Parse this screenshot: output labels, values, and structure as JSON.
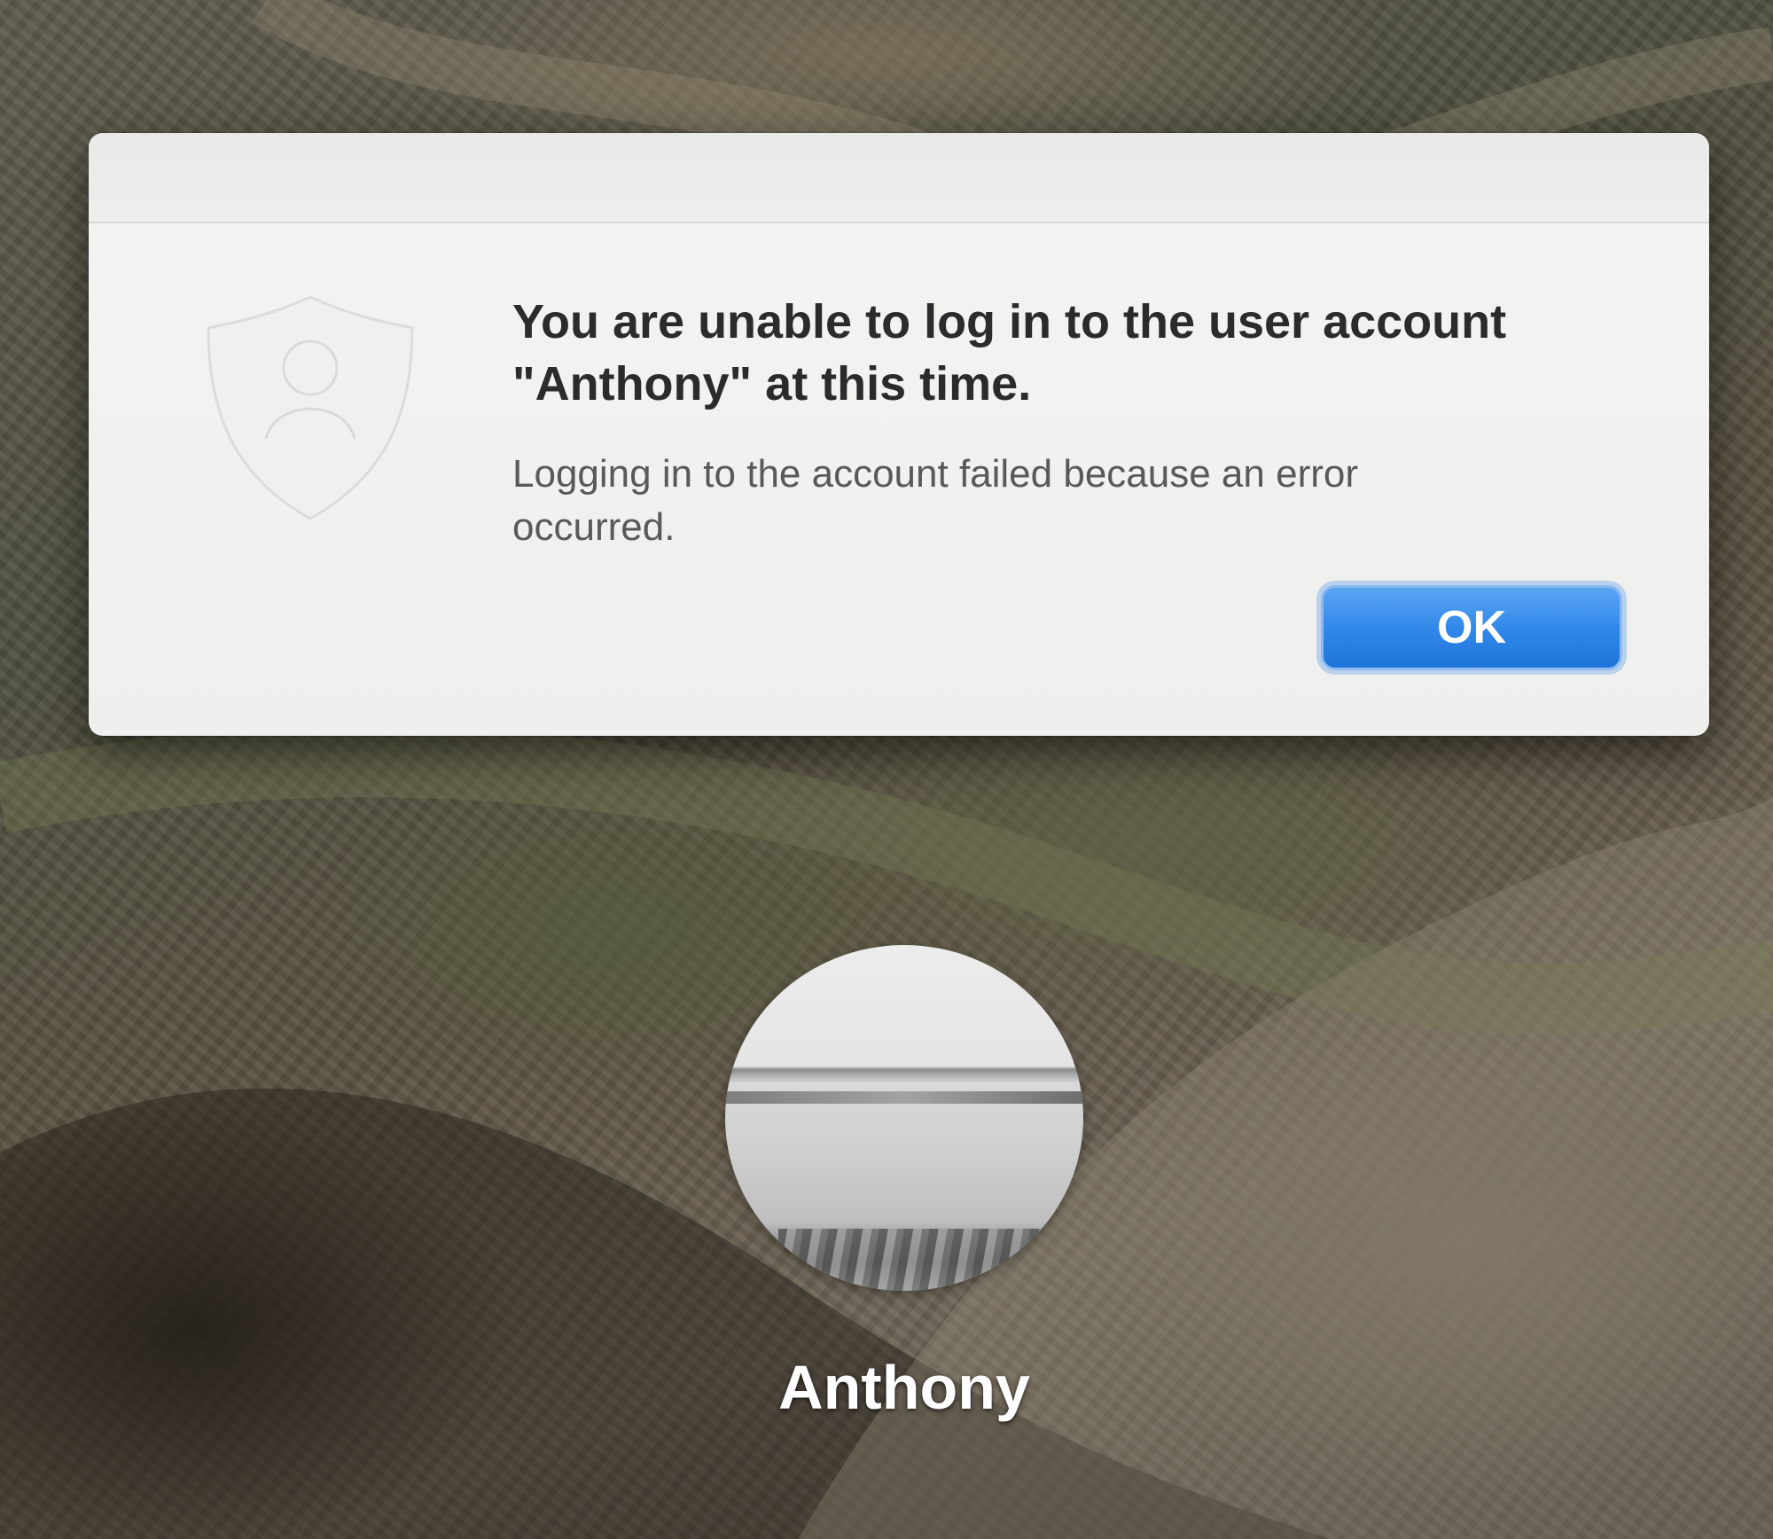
{
  "dialog": {
    "icon": "user-shield-icon",
    "title": "You are unable to log in to the user account \"Anthony\" at this time.",
    "message": "Logging in to the account failed because an error occurred.",
    "ok_label": "OK"
  },
  "login": {
    "user_name": "Anthony",
    "avatar": "user-avatar-photo"
  },
  "colors": {
    "accent": "#2f86e8",
    "dialog_background": "#efefee",
    "title_text": "#2b2b2b",
    "message_text": "#595959"
  }
}
